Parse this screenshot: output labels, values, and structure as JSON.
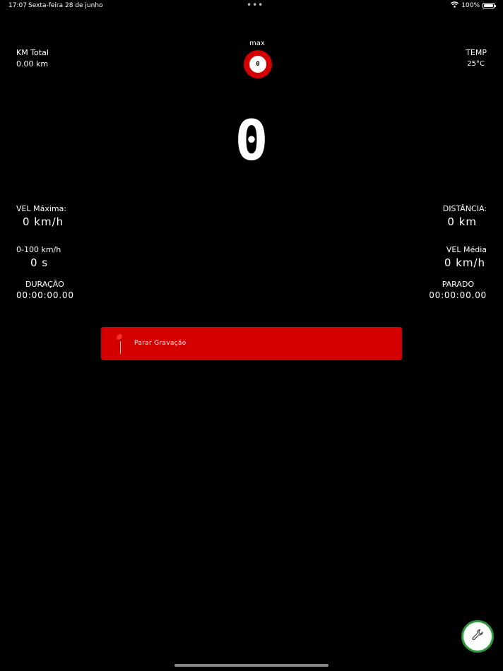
{
  "status_bar": {
    "time": "17:07",
    "date": "Sexta-feira 28 de junho",
    "dots": "•••",
    "battery": "100%"
  },
  "km_total": {
    "label": "KM Total",
    "value": "0.00 km"
  },
  "speed_limit": {
    "label": "max",
    "value": "0"
  },
  "temp": {
    "label": "TEMP",
    "value": "25°C"
  },
  "speed": {
    "value": "0"
  },
  "stats": {
    "vel_max": {
      "label": "VEL Máxima:",
      "value": "0 km/h"
    },
    "distancia": {
      "label": "DISTÂNCIA:",
      "value": "0 km"
    },
    "zero_cem": {
      "label": "0-100 km/h",
      "value": "0 s"
    },
    "vel_media": {
      "label": "VEL Média",
      "value": "0 km/h"
    },
    "duracao": {
      "label": "DURAÇÃO",
      "value": "00:00:00.00"
    },
    "parado": {
      "label": "PARADO",
      "value": "00:00:00.00"
    }
  },
  "record_button": {
    "label": "Parar Gravação"
  },
  "settings_button": {
    "icon": "wrench-icon"
  },
  "colors": {
    "accent": "#d40000",
    "fab_border": "#2e9a3c",
    "background": "#000000"
  }
}
